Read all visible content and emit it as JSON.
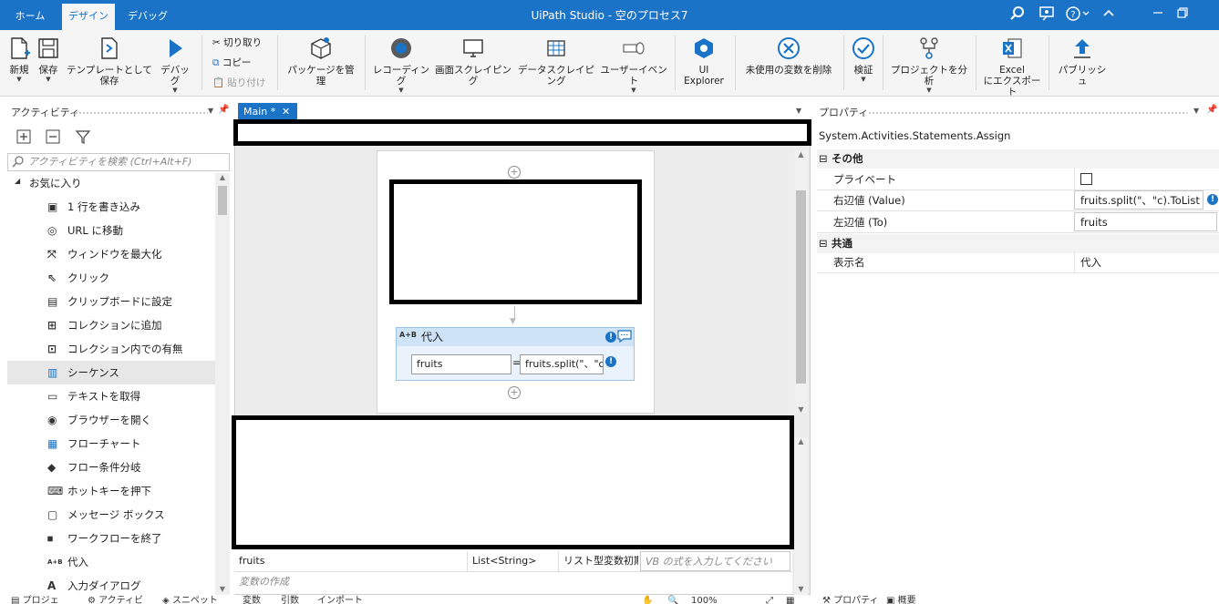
{
  "app": {
    "title": "UiPath Studio - 空のプロセス7"
  },
  "tabs": [
    "ホーム",
    "デザイン",
    "デバッグ"
  ],
  "ribbon": {
    "new": "新規",
    "save": "保存",
    "save_template": "テンプレートとして保存",
    "debug": "デバッグ",
    "cut": "切り取り",
    "copy": "コピー",
    "paste": "貼り付け",
    "manage_packages": "パッケージを管理",
    "recording": "レコーディング",
    "screen_scraping": "画面スクレイピング",
    "data_scraping": "データスクレイピング",
    "user_events": "ユーザーイベント",
    "ui_explorer_1": "UI",
    "ui_explorer_2": "Explorer",
    "remove_unused": "未使用の変数を削除",
    "validate": "検証",
    "analyze": "プロジェクトを分析",
    "excel_1": "Excel",
    "excel_2": "にエクスポート",
    "publish": "パブリッシュ"
  },
  "activities": {
    "title": "アクティビティ",
    "search_placeholder": "アクティビティを検索 (Ctrl+Alt+F)",
    "favorites": "お気に入り",
    "items": [
      "1 行を書き込み",
      "URL に移動",
      "ウィンドウを最大化",
      "クリック",
      "クリップボードに設定",
      "コレクションに追加",
      "コレクション内での有無",
      "シーケンス",
      "テキストを取得",
      "ブラウザーを開く",
      "フローチャート",
      "フロー条件分岐",
      "ホットキーを押下",
      "メッセージ ボックス",
      "ワークフローを終了",
      "代入",
      "入力ダイアログ"
    ]
  },
  "document_tab": "Main *",
  "assign": {
    "title": "代入",
    "to": "fruits",
    "equals": "=",
    "value": "fruits.split(\"、\"c)"
  },
  "variables": {
    "name": "fruits",
    "type": "List<String>",
    "scope": "リスト型変数初期",
    "default_placeholder": "VB の式を入力してください",
    "create": "変数の作成"
  },
  "bottom_tabs": {
    "left": [
      "プロジェ",
      "アクティビ",
      "スニペット"
    ],
    "middle": [
      "変数",
      "引数",
      "インポート"
    ],
    "zoom": "100%",
    "right": [
      "プロパティ",
      "概要"
    ]
  },
  "properties": {
    "title": "プロパティ",
    "class": "System.Activities.Statements.Assign",
    "cat_other": "その他",
    "private": "プライベート",
    "value_label": "右辺値 (Value)",
    "value": "fruits.split(\"、\"c).ToList",
    "to_label": "左辺値 (To)",
    "to": "fruits",
    "cat_common": "共通",
    "display_name_label": "表示名",
    "display_name": "代入"
  },
  "colors": {
    "accent": "#1a73c6",
    "selection": "#e7e7e7"
  }
}
